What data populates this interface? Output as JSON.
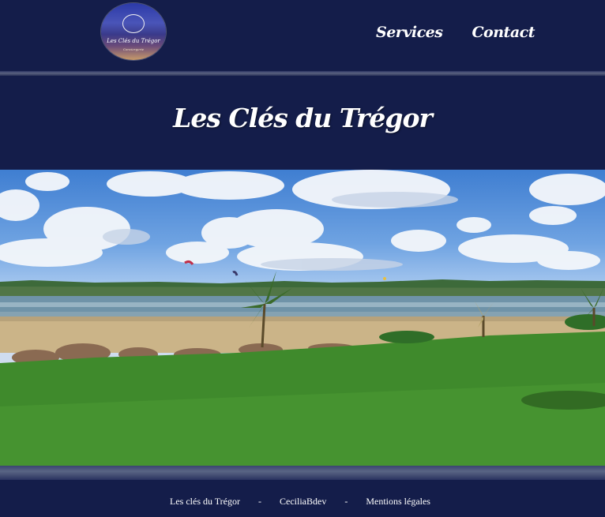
{
  "header": {
    "logo": {
      "text": "Les Clés du Trégor",
      "subtext": "Conciergerie"
    },
    "nav": [
      {
        "label": "Services"
      },
      {
        "label": "Contact"
      }
    ]
  },
  "main": {
    "title": "Les Clés du Trégor"
  },
  "footer": {
    "links": [
      {
        "label": "Les clés du Trégor"
      },
      {
        "label": "CeciliaBdev"
      },
      {
        "label": "Mentions légales"
      }
    ],
    "separator": "-"
  },
  "colors": {
    "background": "#141d4a",
    "text": "#ffffff"
  }
}
